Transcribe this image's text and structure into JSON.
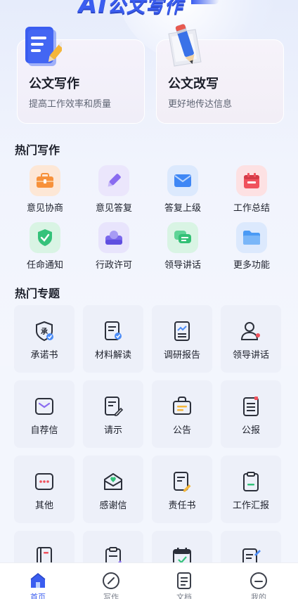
{
  "banner": {
    "title_ai": "AI",
    "title_rest": "公文写作"
  },
  "features": [
    {
      "title": "公文写作",
      "subtitle": "提高工作效率和质量",
      "icon": "document-icon"
    },
    {
      "title": "公文改写",
      "subtitle": "更好地传达信息",
      "icon": "pencil-scroll-icon"
    }
  ],
  "hot_writing": {
    "title": "热门写作",
    "items": [
      {
        "label": "意见协商",
        "icon": "briefcase-icon",
        "color": "#f7913a"
      },
      {
        "label": "意见答复",
        "icon": "pen-icon",
        "color": "#8a6cf0"
      },
      {
        "label": "答复上级",
        "icon": "envelope-icon",
        "color": "#3f87f5"
      },
      {
        "label": "工作总结",
        "icon": "calendar-icon",
        "color": "#f0525d"
      },
      {
        "label": "任命通知",
        "icon": "shield-check-icon",
        "color": "#34c27a"
      },
      {
        "label": "行政许可",
        "icon": "user-card-icon",
        "color": "#7a68ec"
      },
      {
        "label": "领导讲话",
        "icon": "chat-icon",
        "color": "#33c075"
      },
      {
        "label": "更多功能",
        "icon": "folder-icon",
        "color": "#4a9af5"
      }
    ]
  },
  "hot_topics": {
    "title": "热门专题",
    "items": [
      {
        "label": "承诺书",
        "icon": "seal-icon"
      },
      {
        "label": "材料解读",
        "icon": "doc-search-icon"
      },
      {
        "label": "调研报告",
        "icon": "chart-doc-icon"
      },
      {
        "label": "领导讲话",
        "icon": "speaker-icon"
      },
      {
        "label": "自荐信",
        "icon": "mail-icon"
      },
      {
        "label": "请示",
        "icon": "doc-edit-icon"
      },
      {
        "label": "公告",
        "icon": "announcement-icon"
      },
      {
        "label": "公报",
        "icon": "bulletin-icon"
      },
      {
        "label": "其他",
        "icon": "more-icon"
      },
      {
        "label": "感谢信",
        "icon": "heart-mail-icon"
      },
      {
        "label": "责任书",
        "icon": "doc-sign-icon"
      },
      {
        "label": "工作汇报",
        "icon": "clipboard-icon"
      },
      {
        "label": "",
        "icon": "notebook-icon"
      },
      {
        "label": "",
        "icon": "clipboard-edit-icon"
      },
      {
        "label": "",
        "icon": "calendar-check-icon"
      },
      {
        "label": "",
        "icon": "doc-pen-icon"
      }
    ]
  },
  "bottom_nav": {
    "items": [
      {
        "label": "首页",
        "icon": "home-icon",
        "active": true
      },
      {
        "label": "写作",
        "icon": "compose-icon",
        "active": false
      },
      {
        "label": "文档",
        "icon": "document-list-icon",
        "active": false
      },
      {
        "label": "我的",
        "icon": "profile-icon",
        "active": false
      }
    ]
  },
  "colors": {
    "accent": "#3a5df0",
    "tile_bg": "#edf0f9",
    "icon_stroke": "#2b2f3a"
  }
}
